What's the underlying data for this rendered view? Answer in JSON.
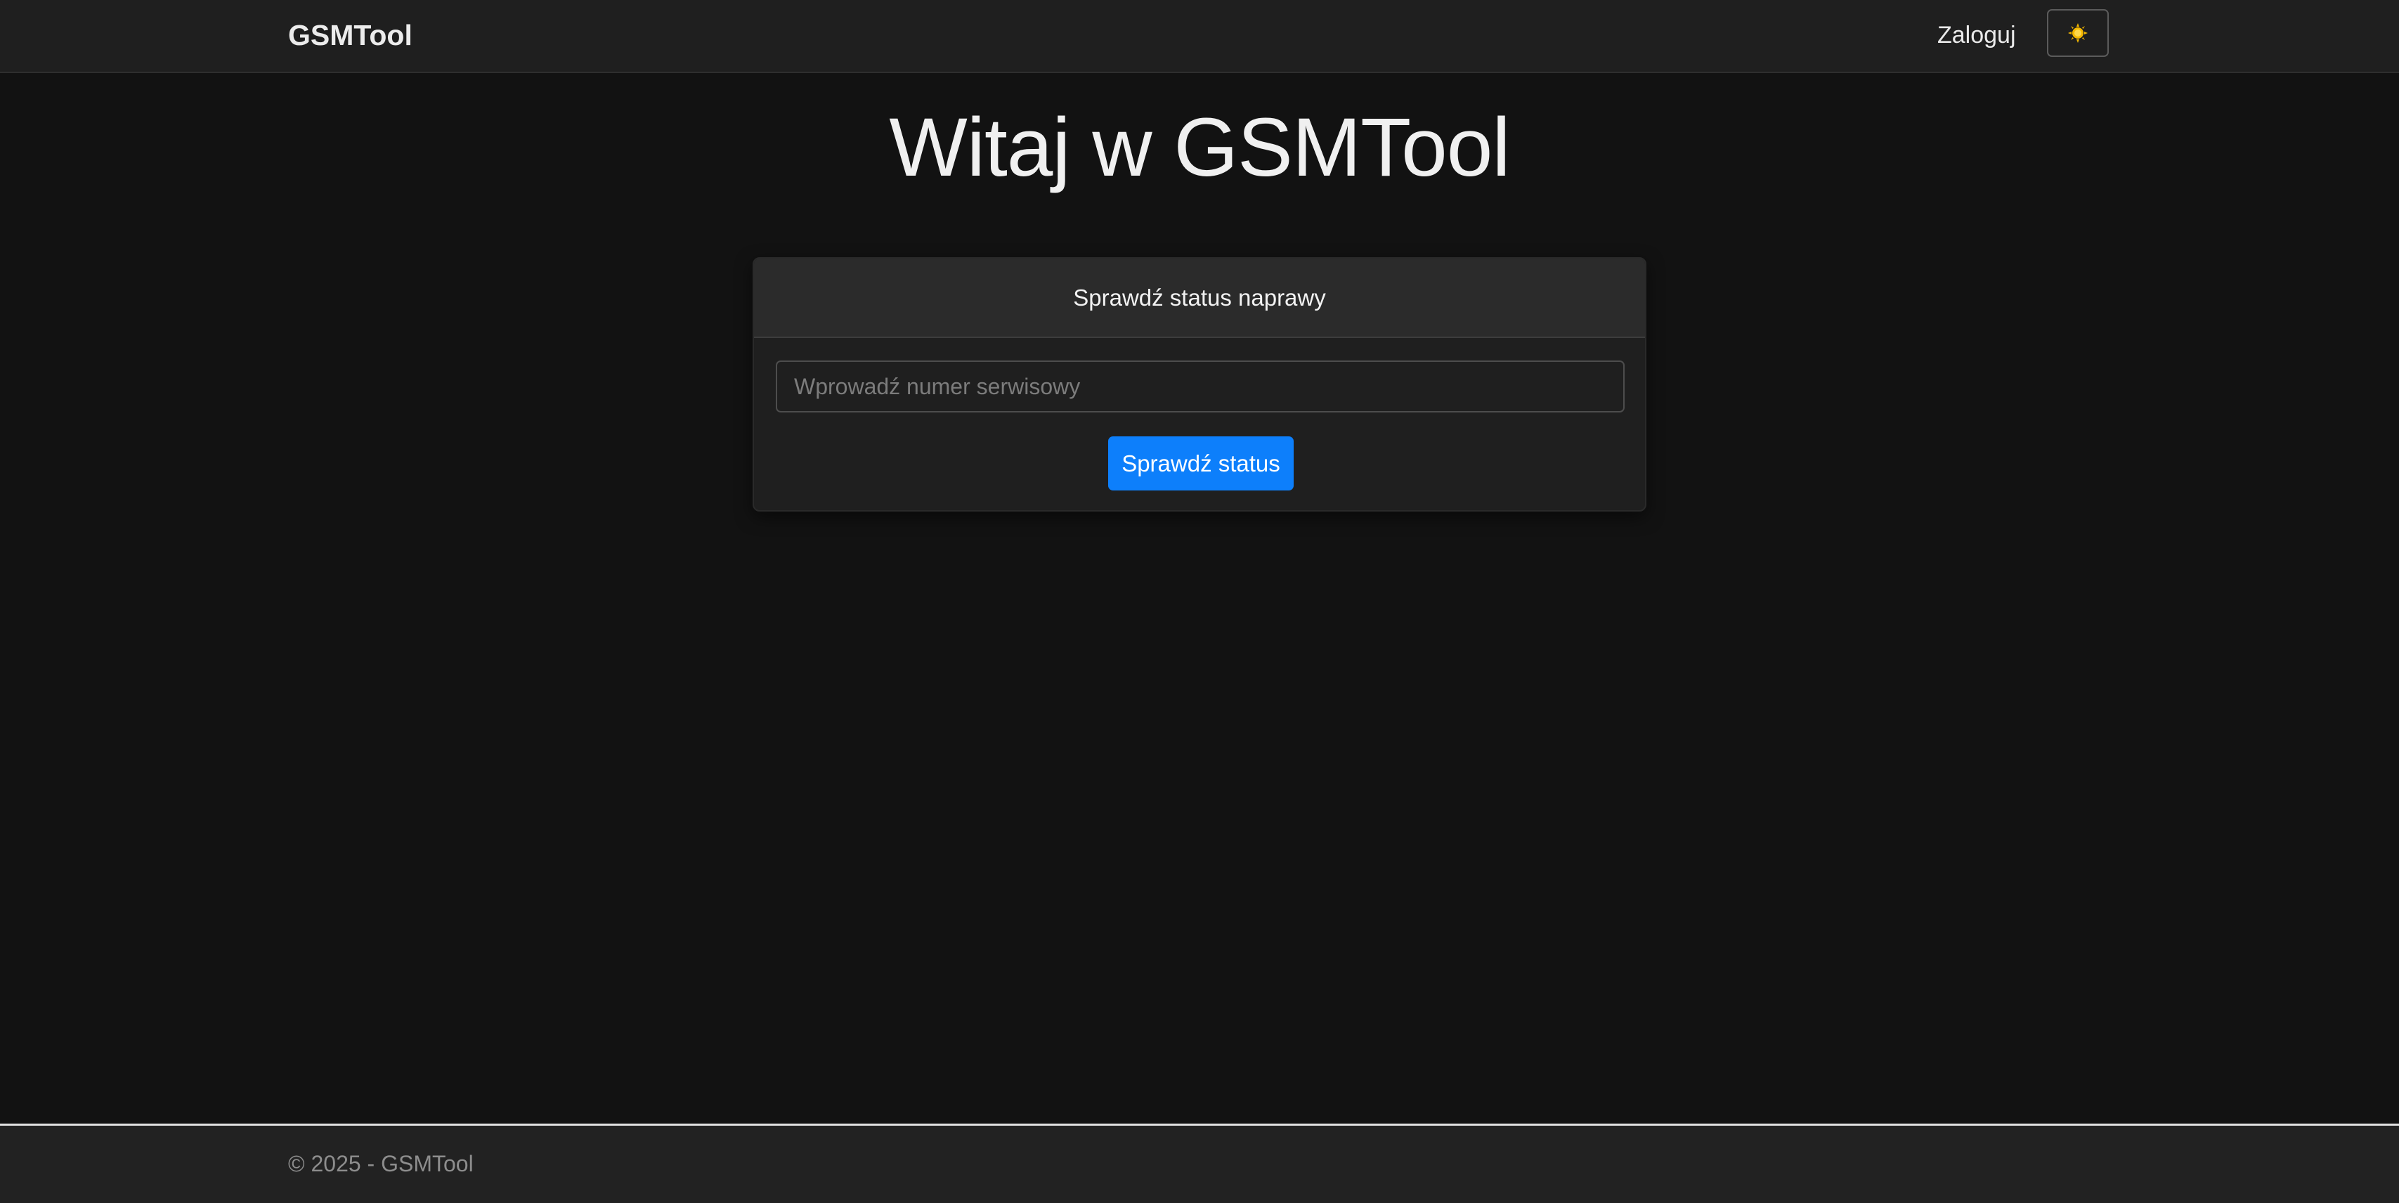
{
  "navbar": {
    "brand": "GSMTool",
    "login_label": "Zaloguj",
    "theme_toggle_icon": "sun-icon"
  },
  "hero": {
    "title": "Witaj w GSMTool"
  },
  "status_card": {
    "header": "Sprawdź status naprawy",
    "input_placeholder": "Wprowadź numer serwisowy",
    "input_value": "",
    "button_label": "Sprawdź status"
  },
  "footer": {
    "text": "© 2025 - GSMTool"
  },
  "colors": {
    "background": "#121212",
    "navbar": "#1f1f1f",
    "accent": "#0d7ffb",
    "sun": "#f5b800"
  }
}
